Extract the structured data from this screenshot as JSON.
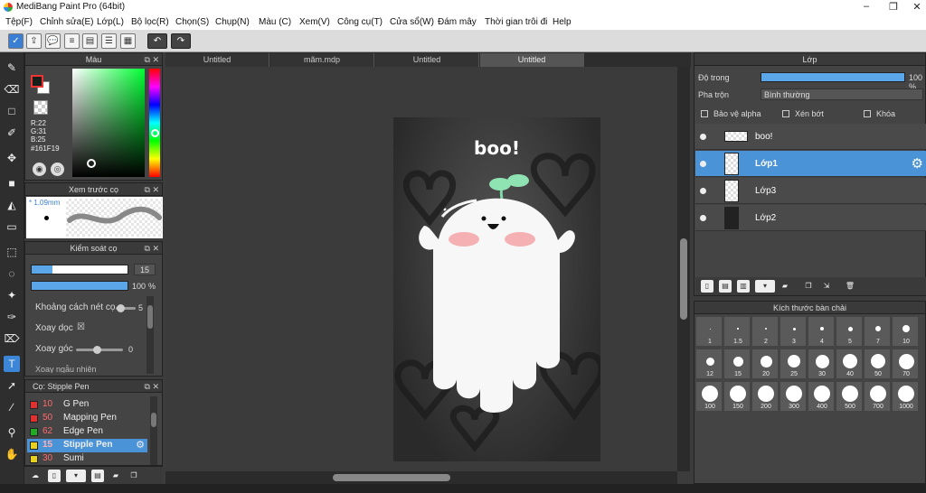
{
  "app": {
    "title": "MediBang Paint Pro (64bit)"
  },
  "menu": [
    "Tệp(F)",
    "Chỉnh sửa(E)",
    "Lớp(L)",
    "Bộ lọc(R)",
    "Chọn(S)",
    "Chụp(N)",
    "Màu (C)",
    "Xem(V)",
    "Công cụ(T)",
    "Cửa sổ(W)",
    "Đám mây",
    "Thời gian trôi đi",
    "Help"
  ],
  "color_panel": {
    "title": "Màu",
    "r": "R:22",
    "g": "G:31",
    "b": "B:25",
    "hex": "#161F19",
    "fg_color": "#161F19",
    "bg_color": "#FFFFFF"
  },
  "preview_panel": {
    "title": "Xem trước cọ",
    "size": "* 1.09mm"
  },
  "control_panel": {
    "title": "Kiểm soát cọ",
    "size_value": "15",
    "size_fraction": 0.22,
    "opacity_value": "100",
    "opacity_unit": "%",
    "opacity_fraction": 1.0,
    "spacing_label": "Khoảng cách nét cọ",
    "spacing_value": "5",
    "rotate_label": "Xoay dọc",
    "rotate_checked": "☒",
    "angle_label": "Xoay góc",
    "angle_value": "0",
    "extra_label": "Xoay ngẫu nhiên"
  },
  "brush_panel": {
    "title": "Cọ: Stipple Pen",
    "brushes": [
      {
        "size": "10",
        "name": "G Pen",
        "color": "#e03030"
      },
      {
        "size": "50",
        "name": "Mapping Pen",
        "color": "#e03030"
      },
      {
        "size": "62",
        "name": "Edge Pen",
        "color": "#22aa22"
      },
      {
        "size": "15",
        "name": "Stipple Pen",
        "color": "#e8d020"
      },
      {
        "size": "30",
        "name": "Sumi",
        "color": "#e8d020"
      }
    ]
  },
  "tabs": [
    "Untitled",
    "mãm.mdp",
    "Untitled",
    "Untitled"
  ],
  "canvas": {
    "art_text": "boo!"
  },
  "layer_panel": {
    "title": "Lớp",
    "opacity_label": "Độ trong",
    "opacity_value": "100 %",
    "blend_label": "Pha trộn",
    "blend_value": "Bình thường",
    "protect_alpha": "Bảo vệ alpha",
    "clipping": "Xén bớt",
    "lock": "Khóa",
    "layers": [
      {
        "name": "boo!",
        "selected": false
      },
      {
        "name": "Lớp1",
        "selected": true
      },
      {
        "name": "Lớp3",
        "selected": false
      },
      {
        "name": "Lớp2",
        "selected": false
      }
    ]
  },
  "size_panel": {
    "title": "Kích thước bàn chải",
    "sizes": [
      "1",
      "1.5",
      "2",
      "3",
      "4",
      "5",
      "7",
      "10",
      "12",
      "15",
      "20",
      "25",
      "30",
      "40",
      "50",
      "70",
      "100",
      "150",
      "200",
      "300",
      "400",
      "500",
      "700",
      "1000"
    ]
  },
  "colors": {
    "accent": "#4a93d6",
    "panel": "#444444"
  }
}
